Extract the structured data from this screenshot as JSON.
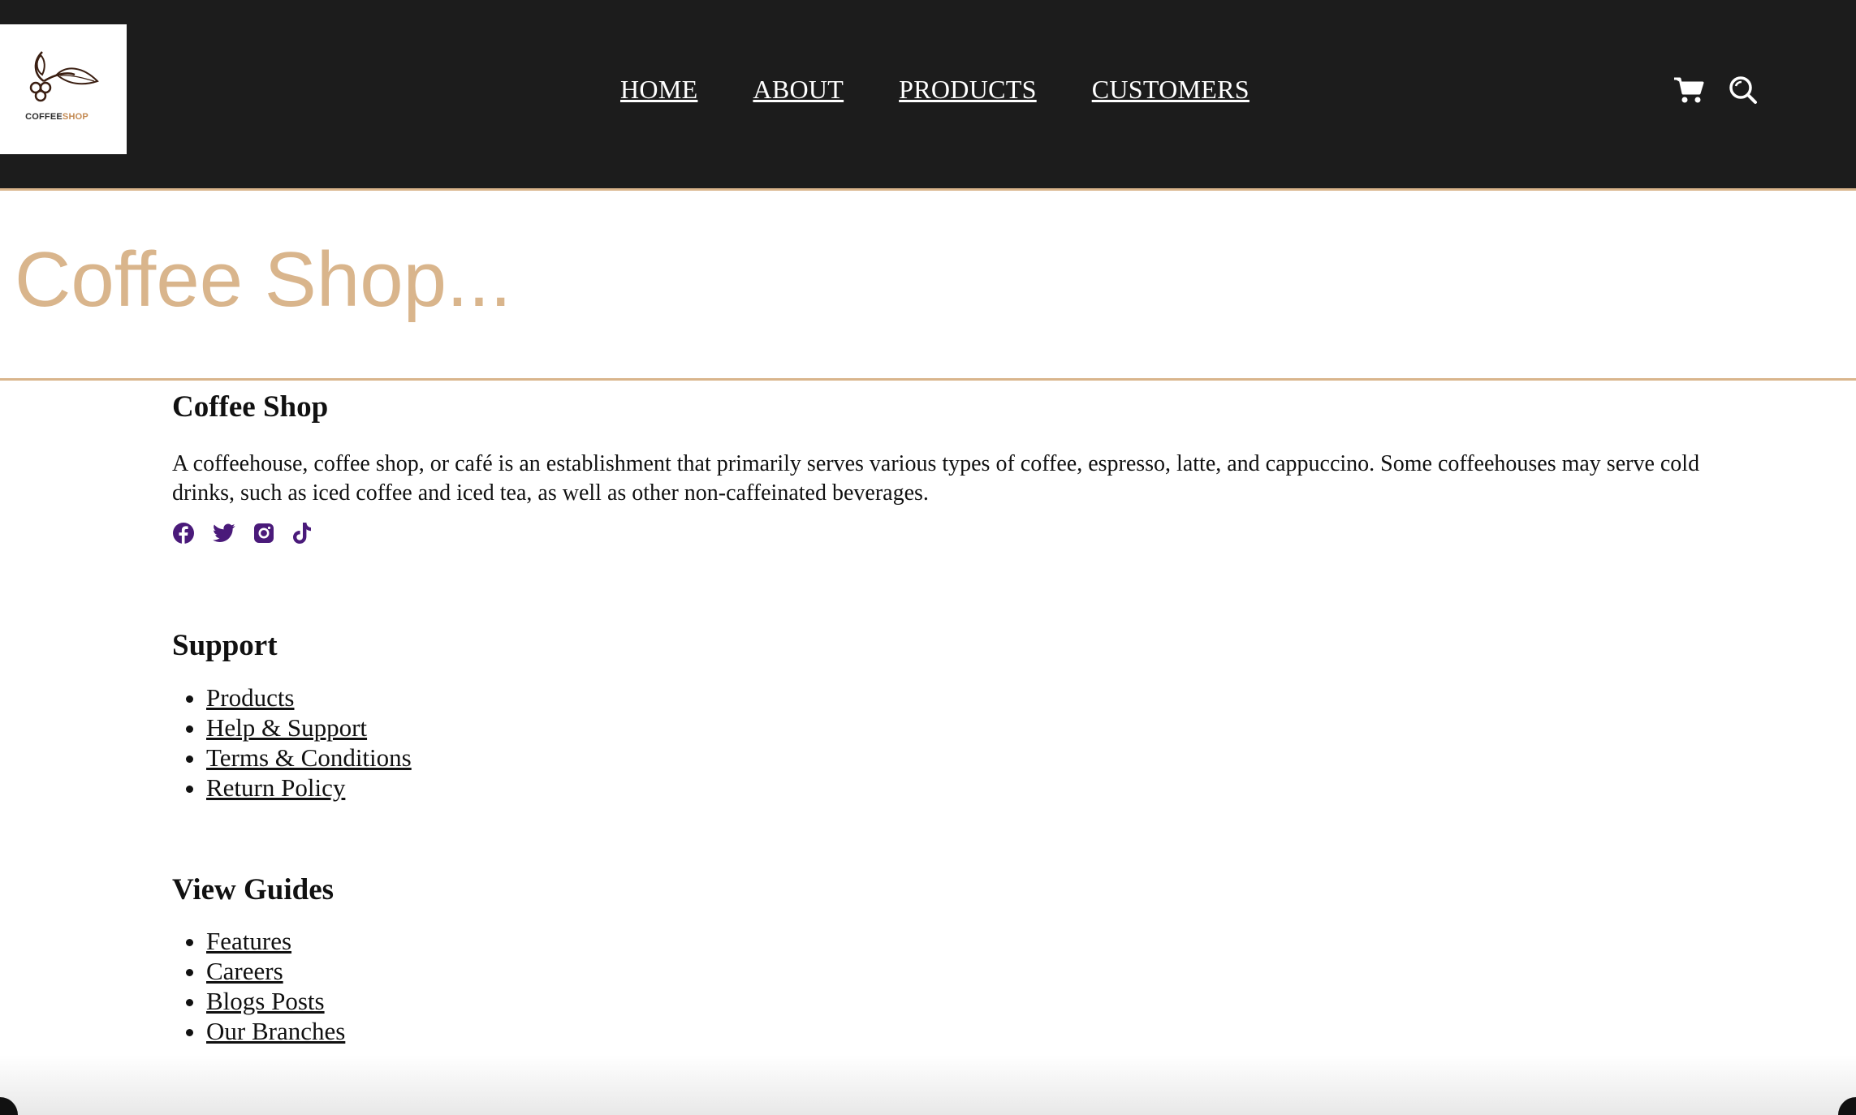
{
  "header": {
    "logo": {
      "name_part1": "COFFEE",
      "name_part2": "SHOP",
      "icon": "coffee-branch-logo"
    },
    "nav": [
      "HOME",
      "ABOUT",
      "PRODUCTS",
      "CUSTOMERS"
    ],
    "icons": [
      "cart-icon",
      "search-icon"
    ]
  },
  "hero": {
    "title": "Coffee Shop..."
  },
  "about": {
    "heading": "Coffee Shop",
    "description": "A coffeehouse, coffee shop, or café is an establishment that primarily serves various types of coffee, espresso, latte, and cappuccino. Some coffeehouses may serve cold drinks, such as iced coffee and iced tea, as well as other non-caffeinated beverages.",
    "socials": [
      "facebook-icon",
      "twitter-icon",
      "instagram-icon",
      "tiktok-icon"
    ],
    "social_color": "#4a1a7a"
  },
  "support": {
    "heading": "Support",
    "links": [
      "Products",
      "Help & Support",
      "Terms & Conditions",
      "Return Policy"
    ]
  },
  "guides": {
    "heading": "View Guides",
    "links": [
      "Features",
      "Careers",
      "Blogs Posts",
      "Our Branches"
    ]
  },
  "colors": {
    "header_bg": "#1c1c1c",
    "accent": "#d9b58c"
  }
}
